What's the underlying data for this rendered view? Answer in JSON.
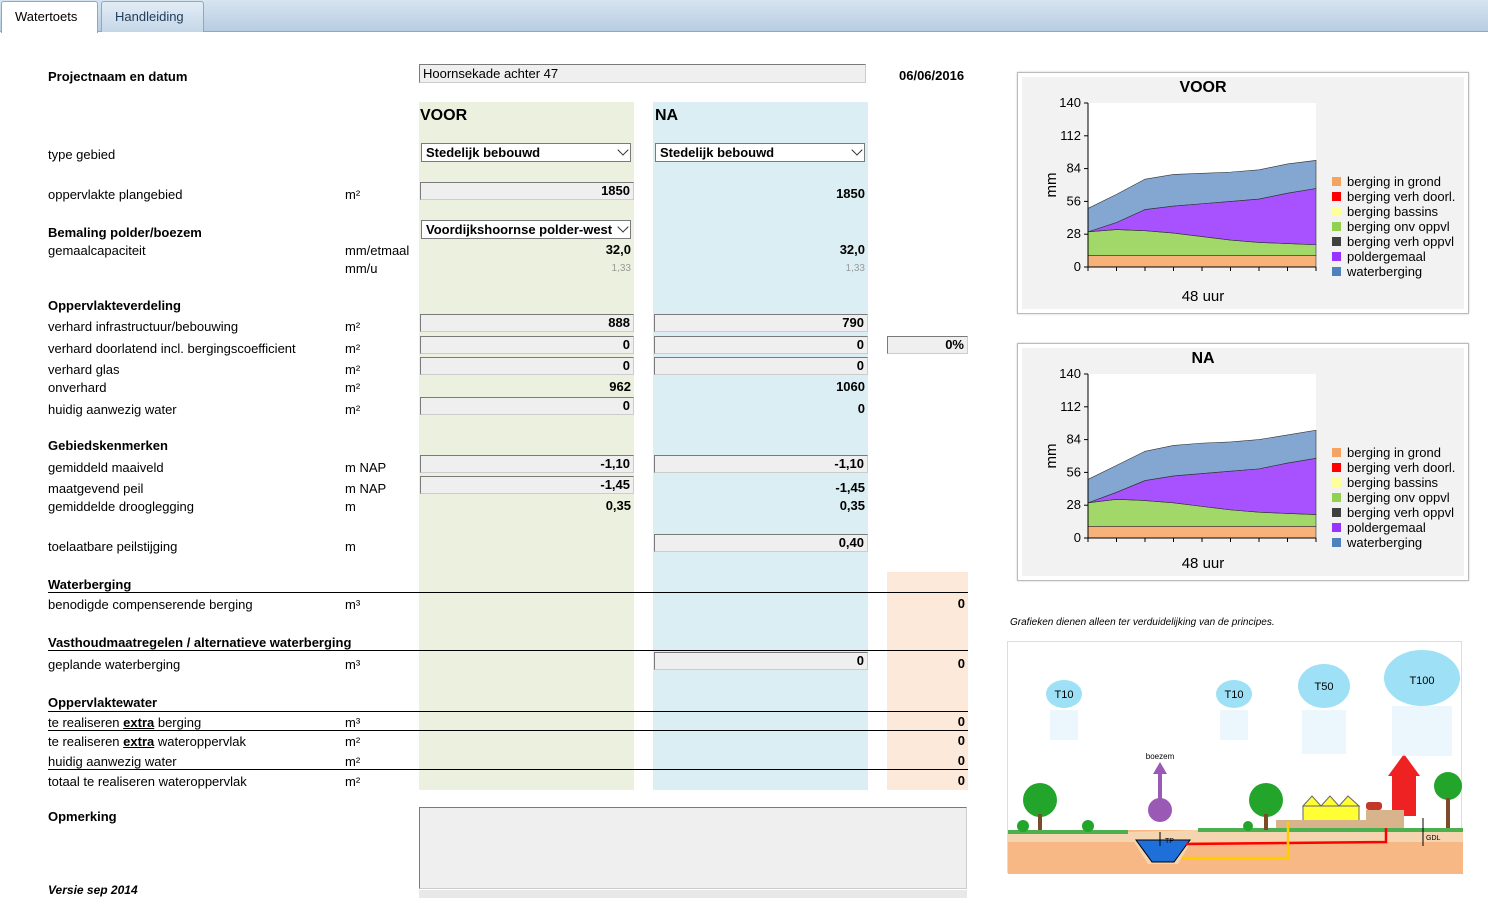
{
  "tabs": {
    "watertoets": "Watertoets",
    "handleiding": "Handleiding"
  },
  "project": {
    "label": "Projectnaam en datum",
    "name": "Hoornsekade achter 47",
    "date": "06/06/2016"
  },
  "columns": {
    "voor": "VOOR",
    "na": "NA"
  },
  "type_gebied": {
    "label": "type gebied",
    "voor": "Stedelijk bebouwd",
    "na": "Stedelijk bebouwd"
  },
  "oppervlakte": {
    "label": "oppervlakte plangebied",
    "unit": "m²",
    "voor": "1850",
    "na": "1850"
  },
  "bemaling": {
    "label": "Bemaling polder/boezem",
    "voor": "Voordijkshoornse polder-west"
  },
  "gemaal": {
    "label": "gemaalcapaciteit",
    "unit": "mm/etmaal",
    "voor": "32,0",
    "na": "32,0",
    "unit2": "mm/u",
    "voor2": "1,33",
    "na2": "1,33"
  },
  "oppervlakteverdeling": {
    "label": "Oppervlakteverdeling"
  },
  "verhard_infra": {
    "label": "verhard infrastructuur/bebouwing",
    "unit": "m²",
    "voor": "888",
    "na": "790"
  },
  "verhard_doorl": {
    "label": "verhard doorlatend incl. bergingscoefficient",
    "unit": "m²",
    "voor": "0",
    "na": "0",
    "pct": "0%"
  },
  "verhard_glas": {
    "label": "verhard glas",
    "unit": "m²",
    "voor": "0",
    "na": "0"
  },
  "onverhard": {
    "label": "onverhard",
    "unit": "m²",
    "voor": "962",
    "na": "1060"
  },
  "huidig_water": {
    "label": "huidig aanwezig water",
    "unit": "m²",
    "voor": "0",
    "na": "0"
  },
  "gebiedskenmerken": {
    "label": "Gebiedskenmerken"
  },
  "maaiveld": {
    "label": "gemiddeld maaiveld",
    "unit": "m NAP",
    "voor": "-1,10",
    "na": "-1,10"
  },
  "peil": {
    "label": "maatgevend peil",
    "unit": "m NAP",
    "voor": "-1,45",
    "na": "-1,45"
  },
  "drooglegging": {
    "label": "gemiddelde drooglegging",
    "unit": "m",
    "voor": "0,35",
    "na": "0,35"
  },
  "peilstijging": {
    "label": "toelaatbare peilstijging",
    "unit": "m",
    "na": "0,40"
  },
  "waterberging": {
    "label": "Waterberging",
    "row_label": "benodigde compenserende berging",
    "unit": "m³",
    "value": "0"
  },
  "vasthoud": {
    "label": "Vasthoudmaatregelen / alternatieve waterberging",
    "row_label": "geplande waterberging",
    "unit": "m³",
    "na": "0",
    "value": "0"
  },
  "oppervlaktewater": {
    "label": "Oppervlaktewater",
    "r1_pre": "te realiseren ",
    "r1_bold": "extra",
    "r1_post": " berging",
    "r1_unit": "m³",
    "r1_val": "0",
    "r2_pre": "te realiseren ",
    "r2_bold": "extra",
    "r2_post": " wateroppervlak",
    "r2_unit": "m²",
    "r2_val": "0",
    "r3": "huidig aanwezig water",
    "r3_unit": "m²",
    "r3_val": "0",
    "r4": "totaal te realiseren wateroppervlak",
    "r4_unit": "m²",
    "r4_val": "0"
  },
  "opmerking": {
    "label": "Opmerking",
    "value": ""
  },
  "versie": "Versie sep 2014",
  "grafiek_note": "Grafieken dienen alleen ter verduidelijking van de principes.",
  "legend": [
    "berging in grond",
    "berging verh doorl.",
    "berging bassins",
    "berging onv oppvl",
    "berging verh oppvl",
    "poldergemaal",
    "waterberging"
  ],
  "legend_colors": [
    "#f4a460",
    "#ff0000",
    "#ffff99",
    "#92d050",
    "#404040",
    "#9933ff",
    "#4f81bd"
  ],
  "illustration": {
    "t10a": "T10",
    "t10b": "T10",
    "t50": "T50",
    "t100": "T100",
    "boezem": "boezem",
    "tp": "TP",
    "gdl": "GDL"
  },
  "chart_data": [
    {
      "type": "area",
      "title": "VOOR",
      "xlabel": "48 uur",
      "ylabel": "mm",
      "ylim": [
        0,
        140
      ],
      "yticks": [
        0,
        28,
        56,
        84,
        112,
        140
      ],
      "x": [
        0,
        6,
        12,
        18,
        24,
        30,
        36,
        42,
        48
      ],
      "series": [
        {
          "name": "berging in grond",
          "values": [
            10,
            10,
            10,
            10,
            10,
            10,
            10,
            10,
            10
          ]
        },
        {
          "name": "berging onv oppvl",
          "values": [
            20,
            22,
            21,
            19,
            16,
            13,
            11,
            10,
            9
          ]
        },
        {
          "name": "poldergemaal",
          "values": [
            0,
            6,
            18,
            23,
            28,
            33,
            37,
            43,
            48
          ]
        },
        {
          "name": "waterberging",
          "values": [
            20,
            24,
            26,
            27,
            26,
            25,
            25,
            25,
            24
          ]
        }
      ]
    },
    {
      "type": "area",
      "title": "NA",
      "xlabel": "48 uur",
      "ylabel": "mm",
      "ylim": [
        0,
        140
      ],
      "yticks": [
        0,
        28,
        56,
        84,
        112,
        140
      ],
      "x": [
        0,
        6,
        12,
        18,
        24,
        30,
        36,
        42,
        48
      ],
      "series": [
        {
          "name": "berging in grond",
          "values": [
            10,
            10,
            10,
            10,
            10,
            10,
            10,
            10,
            10
          ]
        },
        {
          "name": "berging onv oppvl",
          "values": [
            20,
            23,
            22,
            20,
            17,
            14,
            12,
            11,
            10
          ]
        },
        {
          "name": "poldergemaal",
          "values": [
            0,
            6,
            17,
            23,
            28,
            33,
            37,
            43,
            48
          ]
        },
        {
          "name": "waterberging",
          "values": [
            20,
            23,
            25,
            26,
            26,
            25,
            25,
            24,
            24
          ]
        }
      ]
    }
  ]
}
